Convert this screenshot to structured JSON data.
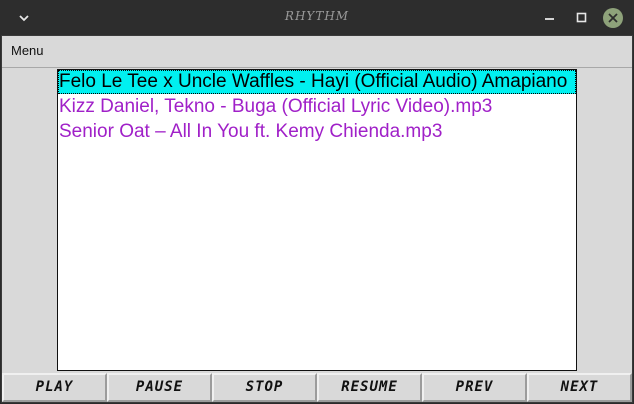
{
  "window": {
    "title": "RHYTHM"
  },
  "menubar": {
    "menu_label": "Menu"
  },
  "playlist": {
    "selected_index": 0,
    "items": [
      "Felo Le Tee x Uncle Waffles - Hayi (Official Audio) Amapiano",
      "Kizz Daniel, Tekno - Buga (Official Lyric Video).mp3",
      "Senior Oat – All In You ft. Kemy Chienda.mp3"
    ]
  },
  "controls": {
    "play": "PLAY",
    "pause": "PAUSE",
    "stop": "STOP",
    "resume": "RESUME",
    "prev": "PREV",
    "next": "NEXT"
  },
  "colors": {
    "selection_bg": "#00f0f0",
    "item_text": "#a020c8",
    "close_button": "#8ea27a"
  },
  "icons": {
    "window_menu": "chevron-down-icon",
    "minimize": "minimize-icon",
    "maximize": "maximize-icon",
    "close": "close-icon"
  }
}
